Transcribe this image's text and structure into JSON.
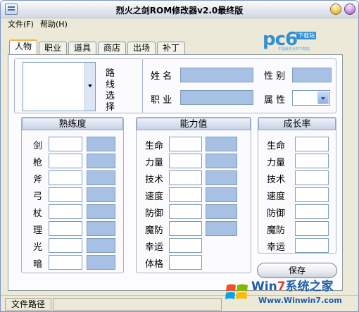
{
  "window": {
    "title": "烈火之剑ROM修改器v2.0最终版"
  },
  "menu": {
    "file": "文件(F)",
    "help": "帮助(H)"
  },
  "tabs": [
    "人物",
    "职业",
    "道具",
    "商店",
    "出场",
    "补丁"
  ],
  "logo": {
    "main": "pc6",
    "badge": "下载站",
    "sub": "中国最安全的下载站"
  },
  "character": {
    "route_select_label": "路线选择",
    "name_label": "姓 名",
    "gender_label": "性 别",
    "class_label": "职 业",
    "attribute_label": "属 性"
  },
  "proficiency": {
    "header": "熟练度",
    "rows": [
      "剑",
      "枪",
      "斧",
      "弓",
      "杖",
      "理",
      "光",
      "暗"
    ]
  },
  "ability": {
    "header": "能力值",
    "rows": [
      "生命",
      "力量",
      "技术",
      "速度",
      "防御",
      "魔防",
      "幸运",
      "体格"
    ]
  },
  "growth": {
    "header": "成长率",
    "rows": [
      "生命",
      "力量",
      "技术",
      "速度",
      "防御",
      "魔防",
      "幸运"
    ]
  },
  "buttons": {
    "save": "保存"
  },
  "status": {
    "file_path_label": "文件路径"
  },
  "watermark": {
    "title_pre": "Win",
    "title_seven": "7",
    "title_post": "系统之家",
    "url": "Www.Winwin7.com"
  },
  "colors": {
    "field_blue": "#a6c1e4",
    "tab_highlight": "#f4b34a",
    "logo_blue": "#2f8fd5"
  }
}
